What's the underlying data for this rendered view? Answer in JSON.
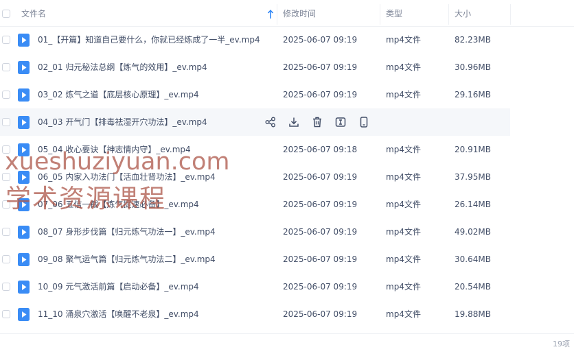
{
  "header": {
    "name_label": "文件名",
    "time_label": "修改时间",
    "type_label": "类型",
    "size_label": "大小"
  },
  "files": [
    {
      "name": "01_【开篇】知道自己要什么，你就已经炼成了一半_ev.mp4",
      "time": "2025-06-07 09:19",
      "type": "mp4文件",
      "size": "82.23MB"
    },
    {
      "name": "02_01 归元秘法总纲【炼气的效用】_ev.mp4",
      "time": "2025-06-07 09:19",
      "type": "mp4文件",
      "size": "30.96MB"
    },
    {
      "name": "03_02 炼气之道【底层核心原理】_ev.mp4",
      "time": "2025-06-07 09:19",
      "type": "mp4文件",
      "size": "29.16MB"
    },
    {
      "name": "04_03 开气门【排毒祛湿开穴功法】_ev.mp4",
      "time": "",
      "type": "",
      "size": ""
    },
    {
      "name": "05_04 收心要诀【神志情内守】_ev.mp4",
      "time": "2025-06-07 09:18",
      "type": "mp4文件",
      "size": "20.91MB"
    },
    {
      "name": "06_05 内家入功法门【活血壮肾功法】_ev.mp4",
      "time": "2025-06-07 09:19",
      "type": "mp4文件",
      "size": "37.95MB"
    },
    {
      "name": "07_06 五信一截【炼气提速必备】_ev.mp4",
      "time": "2025-06-07 09:19",
      "type": "mp4文件",
      "size": "26.14MB"
    },
    {
      "name": "08_07 身形步伐篇【归元炼气功法一】_ev.mp4",
      "time": "2025-06-07 09:19",
      "type": "mp4文件",
      "size": "49.02MB"
    },
    {
      "name": "09_08 聚气运气篇【归元炼气功法二】_ev.mp4",
      "time": "2025-06-07 09:19",
      "type": "mp4文件",
      "size": "30.64MB"
    },
    {
      "name": "10_09 元气激活前篇【启动必备】_ev.mp4",
      "time": "2025-06-07 09:19",
      "type": "mp4文件",
      "size": "20.54MB"
    },
    {
      "name": "11_10 涌泉穴激活【唤醒不老泉】_ev.mp4",
      "time": "2025-06-07 09:19",
      "type": "mp4文件",
      "size": "19.88MB"
    }
  ],
  "hover_actions": [
    "share-icon",
    "download-icon",
    "delete-icon",
    "rename-icon",
    "mobile-icon"
  ],
  "footer": {
    "count": "19项"
  },
  "watermark": {
    "line1": "xueshuziyuan.com",
    "line2": "学术资源课程"
  },
  "colors": {
    "accent": "#2f86f6",
    "file_icon": "#3a8cf5",
    "hover_row": "#f5f7fa",
    "text": "#424e67",
    "header_text": "#7d8597"
  }
}
